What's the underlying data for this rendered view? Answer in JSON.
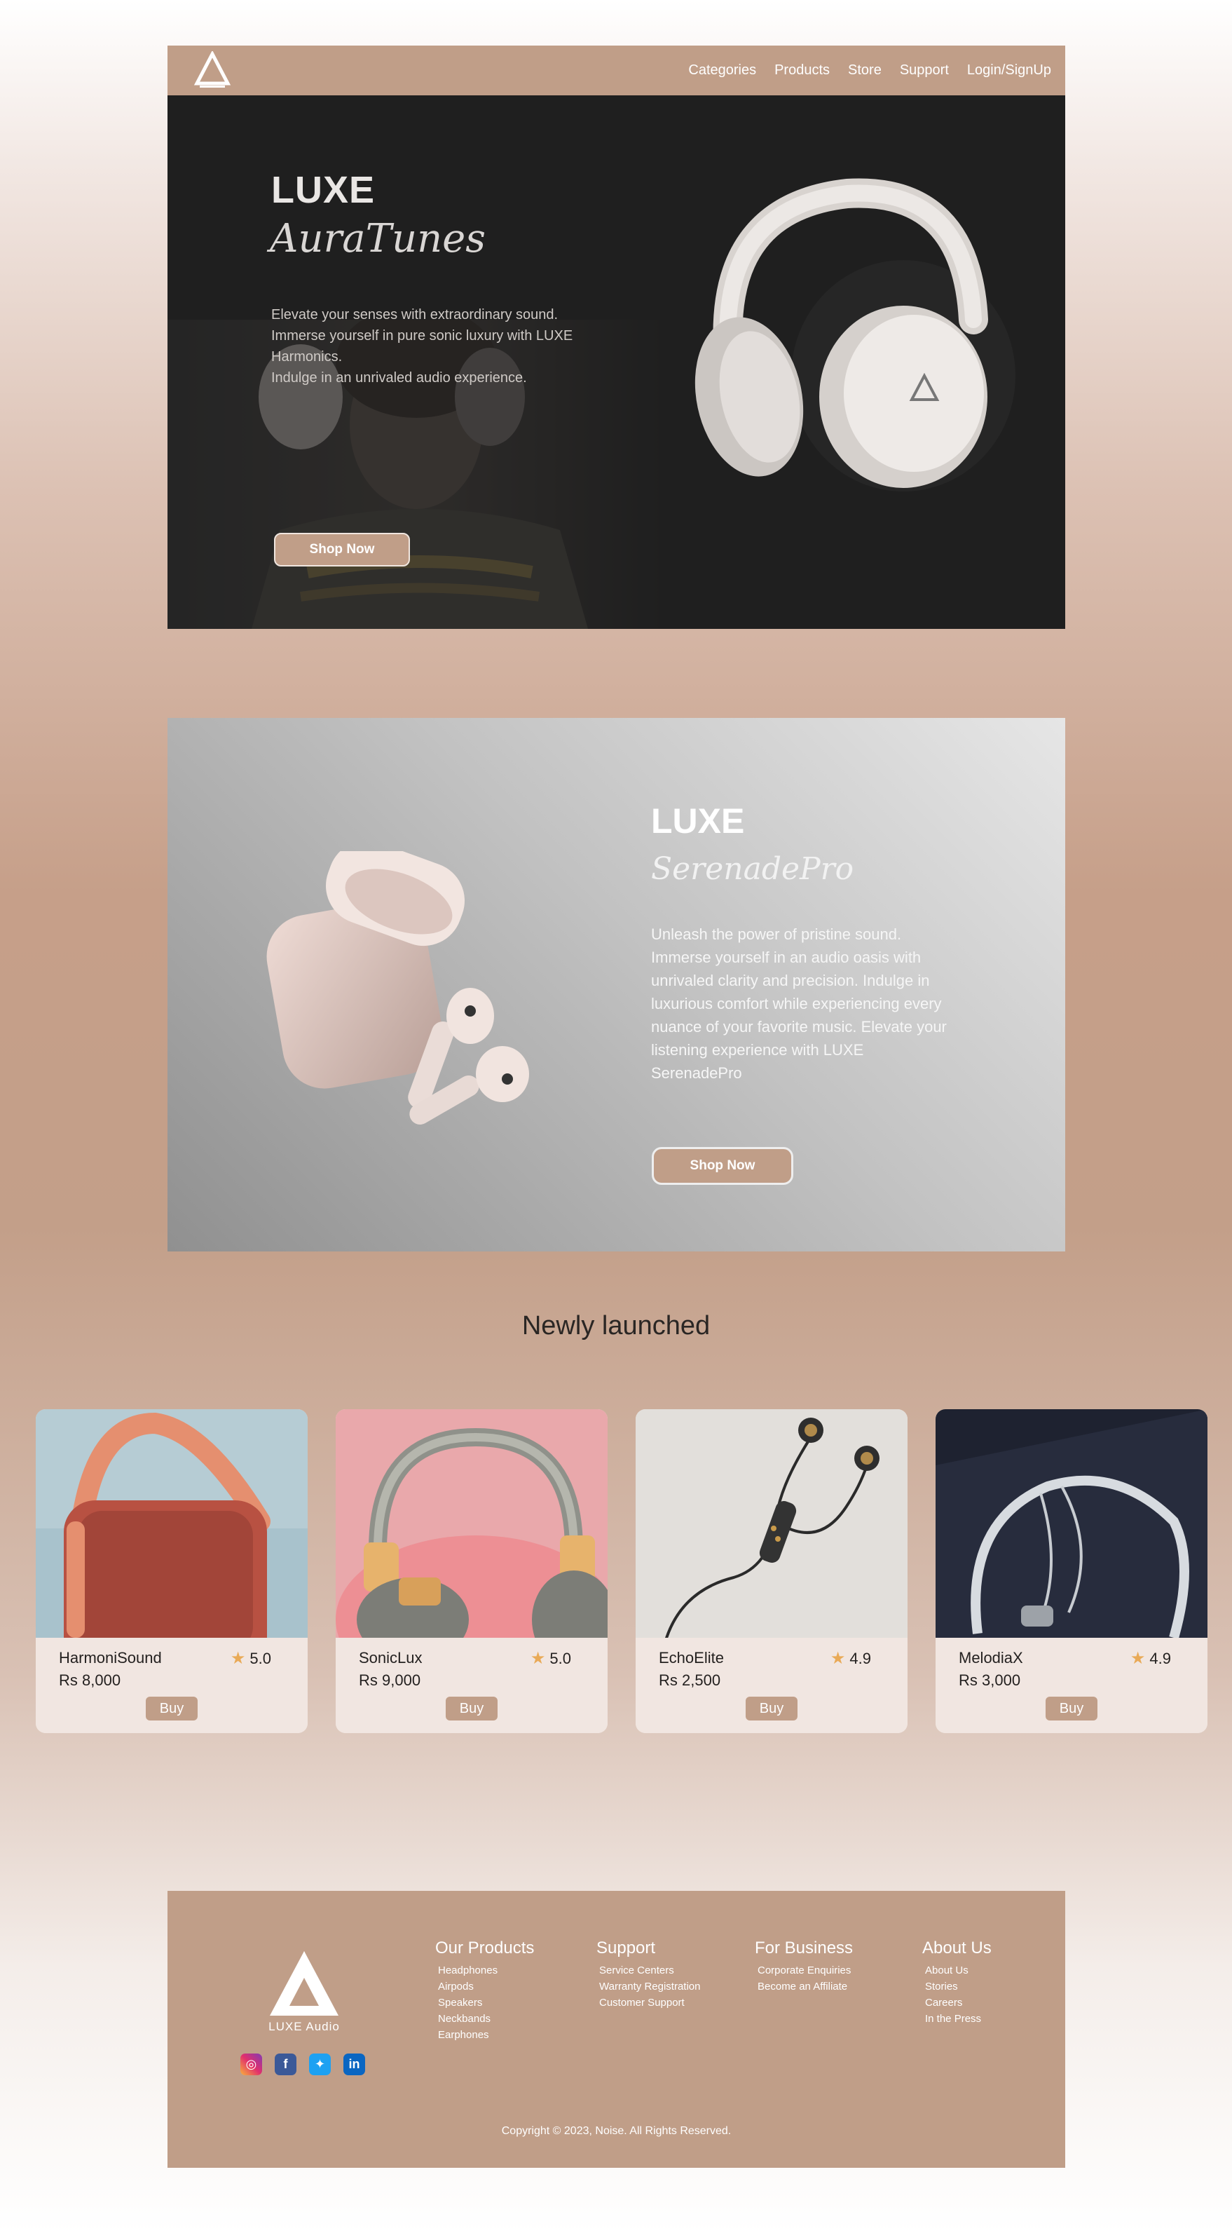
{
  "nav": {
    "logo_icon": "luxe-triangle-logo",
    "links": [
      "Categories",
      "Products",
      "Store",
      "Support",
      "Login/SignUp"
    ]
  },
  "hero1": {
    "brand": "LUXE",
    "product": "AuraTunes",
    "description_lines": [
      "Elevate your senses with extraordinary sound.",
      "Immerse yourself in pure sonic luxury with LUXE Harmonics.",
      "Indulge in an unrivaled audio experience."
    ],
    "cta": "Shop Now"
  },
  "hero2": {
    "brand": "LUXE",
    "product": "SerenadePro",
    "description": "Unleash the power of pristine sound. Immerse yourself in an audio oasis with unrivaled clarity and precision. Indulge in luxurious comfort while experiencing every nuance of your favorite music. Elevate your listening experience with LUXE SerenadePro",
    "cta": "Shop Now"
  },
  "newly_launched": {
    "title": "Newly launched",
    "products": [
      {
        "name": "HarmoniSound",
        "price": "Rs 8,000",
        "rating": "5.0",
        "buy": "Buy",
        "image": "orange-speaker"
      },
      {
        "name": "SonicLux",
        "price": "Rs 9,000",
        "rating": "5.0",
        "buy": "Buy",
        "image": "grey-gold-headphones"
      },
      {
        "name": "EchoElite",
        "price": "Rs 2,500",
        "rating": "4.9",
        "buy": "Buy",
        "image": "black-earphones"
      },
      {
        "name": "MelodiaX",
        "price": "Rs 3,000",
        "rating": "4.9",
        "buy": "Buy",
        "image": "white-neckband"
      }
    ]
  },
  "footer": {
    "brand": "LUXE Audio",
    "columns": [
      {
        "heading": "Our Products",
        "links": [
          "Headphones",
          "Airpods",
          "Speakers",
          "Neckbands",
          "Earphones"
        ]
      },
      {
        "heading": "Support",
        "links": [
          "Service Centers",
          "Warranty Registration",
          "Customer Support"
        ]
      },
      {
        "heading": "For Business",
        "links": [
          "Corporate Enquiries",
          "Become an Affiliate"
        ]
      },
      {
        "heading": "About Us",
        "links": [
          "About Us",
          "Stories",
          "Careers",
          "In the Press"
        ]
      }
    ],
    "socials": [
      "instagram-icon",
      "facebook-icon",
      "twitter-icon",
      "linkedin-icon"
    ],
    "copyright": "Copyright © 2023, Noise. All Rights Reserved."
  },
  "colors": {
    "accent": "#c09e88",
    "hero_dark": "#1f1f1f",
    "card_bg": "#f1e6e1",
    "star": "#e9aa57"
  }
}
